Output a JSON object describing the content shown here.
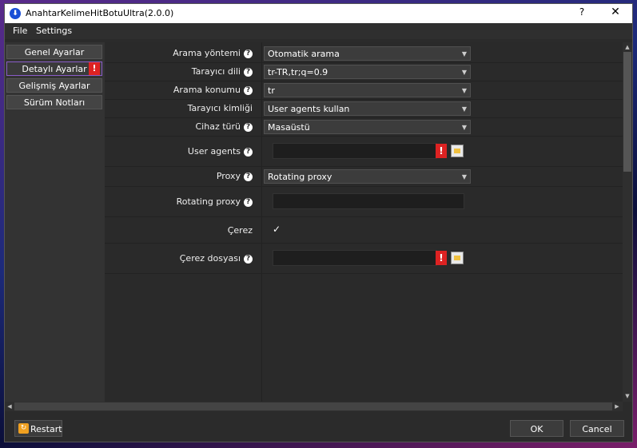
{
  "window": {
    "title": "AnahtarKelimeHitBotuUltra(2.0.0)",
    "help_label": "?",
    "close_label": "✕",
    "app_icon_glyph": "⬇"
  },
  "menu": {
    "file": "File",
    "settings": "Settings"
  },
  "sidebar": {
    "items": [
      {
        "label": "Genel Ayarlar"
      },
      {
        "label": "Detaylı Ayarlar",
        "warning": "!"
      },
      {
        "label": "Gelişmiş Ayarlar"
      },
      {
        "label": "Sürüm Notları"
      }
    ]
  },
  "form": {
    "help_glyph": "?",
    "caret": "▼",
    "warning_glyph": "!",
    "arama_yontemi": {
      "label": "Arama yöntemi",
      "value": "Otomatik arama"
    },
    "tarayici_dili": {
      "label": "Tarayıcı dili",
      "value": "tr-TR,tr;q=0.9"
    },
    "arama_konumu": {
      "label": "Arama konumu",
      "value": "tr"
    },
    "tarayici_kimligi": {
      "label": "Tarayıcı kimliği",
      "value": "User agents kullan"
    },
    "cihaz_turu": {
      "label": "Cihaz türü",
      "value": "Masaüstü"
    },
    "user_agents": {
      "label": "User agents",
      "value": ""
    },
    "proxy": {
      "label": "Proxy",
      "value": "Rotating proxy"
    },
    "rotating_proxy": {
      "label": "Rotating proxy",
      "value": ""
    },
    "cerez": {
      "label": "Çerez",
      "checked": true,
      "check_glyph": "✓"
    },
    "cerez_dosyasi": {
      "label": "Çerez dosyası",
      "value": ""
    }
  },
  "footer": {
    "restart_label": "Restart",
    "restart_icon_glyph": "↻",
    "ok_label": "OK",
    "cancel_label": "Cancel"
  },
  "colors": {
    "warning": "#d22222",
    "accent_border": "#8a5cc8",
    "app_icon": "#1a4fd6"
  }
}
